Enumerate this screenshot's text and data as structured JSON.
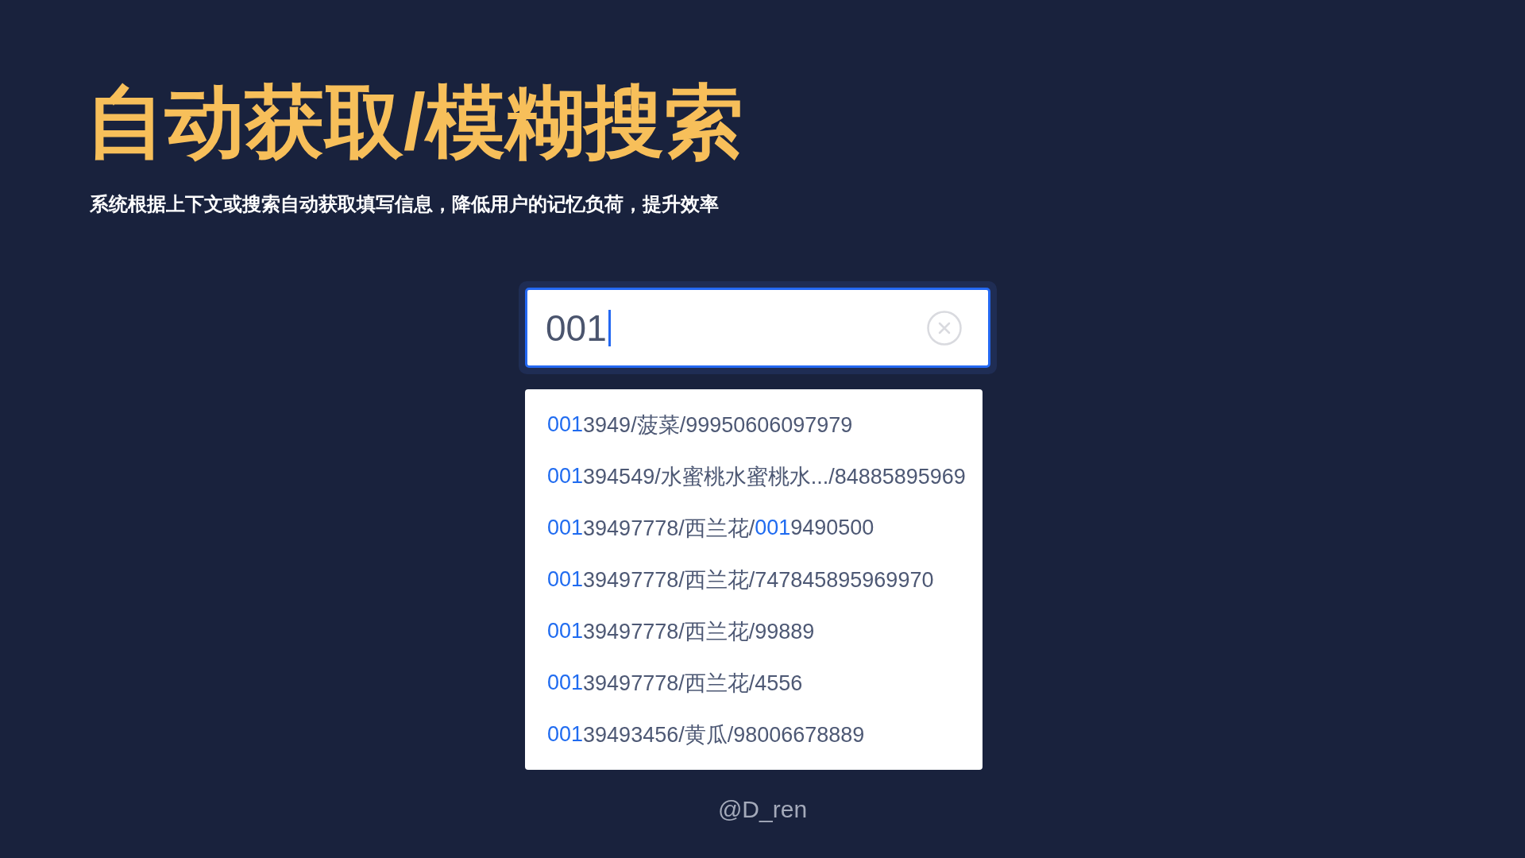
{
  "title": "自动获取/模糊搜索",
  "subtitle": "系统根据上下文或搜索自动获取填写信息，降低用户的记忆负荷，提升效率",
  "search": {
    "value": "001",
    "focused": true
  },
  "suggestions": [
    {
      "selected": false,
      "segments": [
        {
          "text": "001",
          "match": true
        },
        {
          "text": "3949/菠菜/99950606097979",
          "match": false
        }
      ]
    },
    {
      "selected": false,
      "segments": [
        {
          "text": "001",
          "match": true
        },
        {
          "text": "394549/水蜜桃水蜜桃水.../84885895969",
          "match": false
        }
      ]
    },
    {
      "selected": false,
      "segments": [
        {
          "text": "001",
          "match": true
        },
        {
          "text": "39497778/西兰花/",
          "match": false
        },
        {
          "text": "001",
          "match": true
        },
        {
          "text": "9490500",
          "match": false
        }
      ]
    },
    {
      "selected": false,
      "segments": [
        {
          "text": "001",
          "match": true
        },
        {
          "text": "39497778/西兰花/747845895969970",
          "match": false
        }
      ]
    },
    {
      "selected": false,
      "segments": [
        {
          "text": "001",
          "match": true
        },
        {
          "text": "39497778/西兰花/99889",
          "match": false
        }
      ]
    },
    {
      "selected": false,
      "segments": [
        {
          "text": "001",
          "match": true
        },
        {
          "text": "39497778/西兰花/4556",
          "match": false
        }
      ]
    },
    {
      "selected": false,
      "segments": [
        {
          "text": "001",
          "match": true
        },
        {
          "text": "39493456/黄瓜/98006678889",
          "match": false
        }
      ]
    }
  ],
  "credit": "@D_ren"
}
